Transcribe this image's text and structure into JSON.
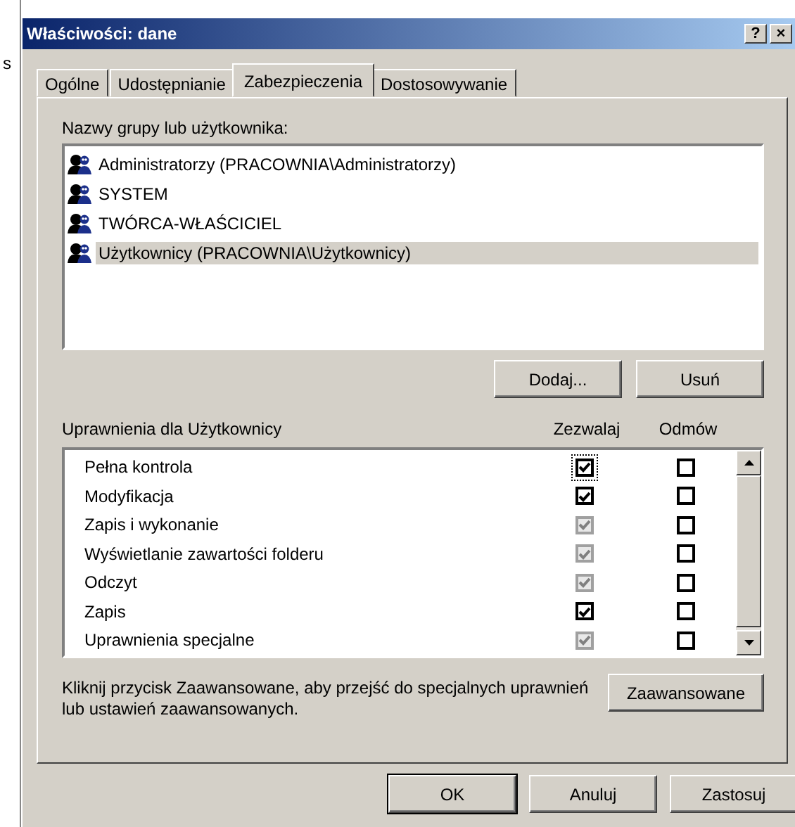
{
  "background_window": {
    "text": "s"
  },
  "window": {
    "title": "Właściwości: dane",
    "title_buttons": [
      "?",
      "×"
    ]
  },
  "tabs": [
    {
      "label": "Ogólne",
      "selected": false
    },
    {
      "label": "Udostępnianie",
      "selected": false
    },
    {
      "label": "Zabezpieczenia",
      "selected": true
    },
    {
      "label": "Dostosowywanie",
      "selected": false
    }
  ],
  "groups": {
    "label": "Nazwy grupy lub użytkownika:",
    "items": [
      {
        "name": "Administratorzy (PRACOWNIA\\Administratorzy)",
        "selected": false
      },
      {
        "name": "SYSTEM",
        "selected": false
      },
      {
        "name": "TWÓRCA-WŁAŚCICIEL",
        "selected": false
      },
      {
        "name": "Użytkownicy (PRACOWNIA\\Użytkownicy)",
        "selected": true
      }
    ],
    "buttons": [
      "Dodaj...",
      "Usuń"
    ]
  },
  "permissions": {
    "label": "Uprawnienia dla Użytkownicy",
    "columns": [
      "Zezwalaj",
      "Odmów"
    ],
    "rows": [
      {
        "name": "Pełna kontrola",
        "allow": {
          "checked": true,
          "disabled": false,
          "focused": true
        },
        "deny": {
          "checked": false,
          "disabled": false
        }
      },
      {
        "name": "Modyfikacja",
        "allow": {
          "checked": true,
          "disabled": false,
          "focused": false
        },
        "deny": {
          "checked": false,
          "disabled": false
        }
      },
      {
        "name": "Zapis i wykonanie",
        "allow": {
          "checked": true,
          "disabled": true,
          "focused": false
        },
        "deny": {
          "checked": false,
          "disabled": false
        }
      },
      {
        "name": "Wyświetlanie zawartości folderu",
        "allow": {
          "checked": true,
          "disabled": true,
          "focused": false
        },
        "deny": {
          "checked": false,
          "disabled": false
        }
      },
      {
        "name": "Odczyt",
        "allow": {
          "checked": true,
          "disabled": true,
          "focused": false
        },
        "deny": {
          "checked": false,
          "disabled": false
        }
      },
      {
        "name": "Zapis",
        "allow": {
          "checked": true,
          "disabled": false,
          "focused": false
        },
        "deny": {
          "checked": false,
          "disabled": false
        }
      },
      {
        "name": "Uprawnienia specjalne",
        "allow": {
          "checked": true,
          "disabled": true,
          "focused": false
        },
        "deny": {
          "checked": false,
          "disabled": false
        }
      }
    ]
  },
  "advanced": {
    "text": "Kliknij przycisk Zaawansowane, aby przejść do specjalnych uprawnień lub ustawień zaawansowanych.",
    "button": "Zaawansowane"
  },
  "buttons": [
    {
      "label": "OK",
      "default": true
    },
    {
      "label": "Anuluj",
      "default": false
    },
    {
      "label": "Zastosuj",
      "default": false
    }
  ]
}
